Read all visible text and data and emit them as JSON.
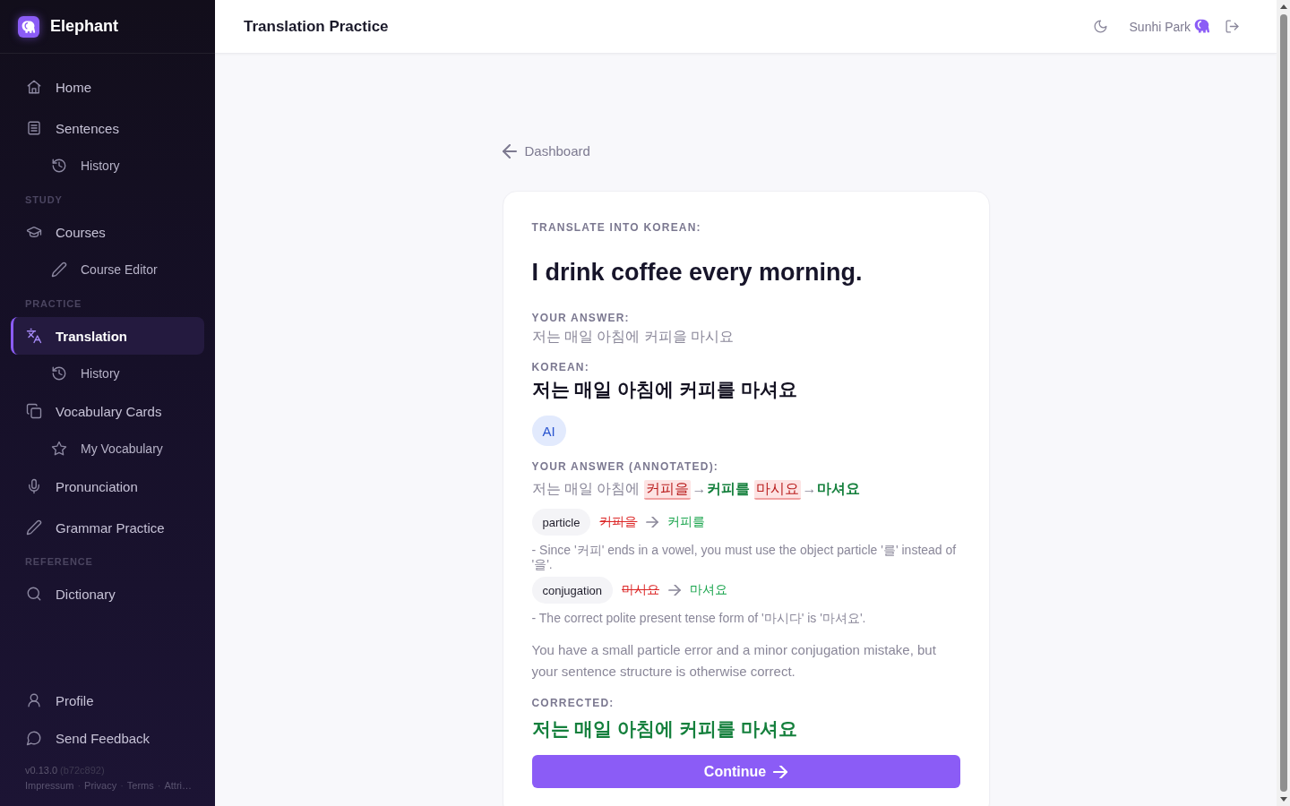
{
  "sidebar": {
    "brand": "Elephant",
    "sections": [
      {
        "items": [
          {
            "label": "Home",
            "selected": false
          },
          {
            "label": "Sentences",
            "selected": false,
            "children": [
              {
                "label": "History",
                "selected": false
              }
            ]
          }
        ]
      },
      {
        "heading": "STUDY",
        "items": [
          {
            "label": "Courses",
            "selected": false,
            "children": [
              {
                "label": "Course Editor",
                "selected": false
              }
            ]
          }
        ]
      },
      {
        "heading": "PRACTICE",
        "items": [
          {
            "label": "Translation",
            "selected": true,
            "children": [
              {
                "label": "History",
                "selected": false
              }
            ]
          },
          {
            "label": "Vocabulary Cards",
            "selected": false,
            "children": [
              {
                "label": "My Vocabulary",
                "selected": false
              }
            ]
          },
          {
            "label": "Pronunciation",
            "selected": false
          },
          {
            "label": "Grammar Practice",
            "selected": false
          }
        ]
      },
      {
        "heading": "REFERENCE",
        "items": [
          {
            "label": "Dictionary",
            "selected": false
          }
        ]
      }
    ],
    "bottom_items": [
      {
        "label": "Profile",
        "selected": false
      },
      {
        "label": "Send Feedback",
        "selected": false
      }
    ],
    "version": "v0.13.0",
    "commit": "(b72c892)",
    "footer": [
      {
        "kind": "link",
        "text": "Impressum"
      },
      {
        "kind": "separator",
        "text": "·"
      },
      {
        "kind": "link",
        "text": "Privacy"
      },
      {
        "kind": "separator",
        "text": "·"
      },
      {
        "kind": "link",
        "text": "Terms"
      },
      {
        "kind": "separator",
        "text": "·"
      },
      {
        "kind": "link",
        "text": "Attri…"
      }
    ]
  },
  "header": {
    "title": "Translation Practice",
    "user_name": "Sunhi Park"
  },
  "back_link": "Dashboard",
  "card": {
    "prompt_label": "TRANSLATE INTO KOREAN:",
    "prompt": "I drink coffee every morning.",
    "answer_label": "YOUR ANSWER:",
    "answer": "저는 매일 아침에 커피을 마시요",
    "korean_label": "KOREAN:",
    "korean": "저는 매일 아침에 커피를 마셔요",
    "badge": "AI",
    "annotated_label": "YOUR ANSWER (ANNOTATED):",
    "annotated": [
      {
        "kind": "plain",
        "text": "저는 매일 아침에"
      },
      {
        "kind": "error",
        "text": "커피을"
      },
      {
        "kind": "arrow",
        "text": "→"
      },
      {
        "kind": "fix",
        "text": "커피를"
      },
      {
        "kind": "error",
        "text": "마시요"
      },
      {
        "kind": "arrow",
        "text": "→"
      },
      {
        "kind": "fix",
        "text": "마셔요"
      }
    ],
    "corrections": [
      {
        "tag": "particle",
        "wrong": "커피을",
        "right": "커피를",
        "explanation": "- Since '커피' ends in a vowel, you must use the object particle '를' instead of '을'."
      },
      {
        "tag": "conjugation",
        "wrong": "마시요",
        "right": "마셔요",
        "explanation": "- The correct polite present tense form of '마시다' is '마셔요'."
      }
    ],
    "summary": "You have a small particle error and a minor conjugation mistake, but your sentence structure is otherwise correct.",
    "corrected_label": "CORRECTED:",
    "corrected": "저는 매일 아침에 커피를 마셔요",
    "button": "Continue"
  }
}
